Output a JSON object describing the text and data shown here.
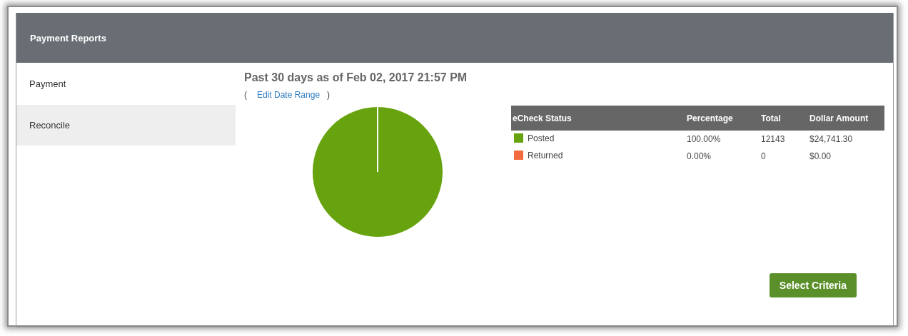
{
  "panel": {
    "title": "Payment Reports"
  },
  "sidebar": {
    "items": [
      {
        "label": "Payment",
        "selected": false
      },
      {
        "label": "Reconcile",
        "selected": true
      }
    ]
  },
  "report": {
    "heading": "Past 30 days as of Feb 02, 2017 21:57 PM",
    "open_paren": "(",
    "link": "Edit Date Range",
    "close_paren": ")",
    "chart_data": {
      "type": "pie",
      "values": [
        100,
        0
      ]
    },
    "table": {
      "columns": [
        "eCheck Status",
        "Percentage",
        "Total",
        "Dollar Amount"
      ],
      "rows": [
        {
          "color": "#66a30e",
          "status": "Posted",
          "percentage": "100.00%",
          "total": "12143",
          "amount": "$24,741.30"
        },
        {
          "color": "#f26a3e",
          "status": "Returned",
          "percentage": "0.00%",
          "total": "0",
          "amount": "$0.00"
        }
      ]
    }
  },
  "button": "Select Criteria"
}
